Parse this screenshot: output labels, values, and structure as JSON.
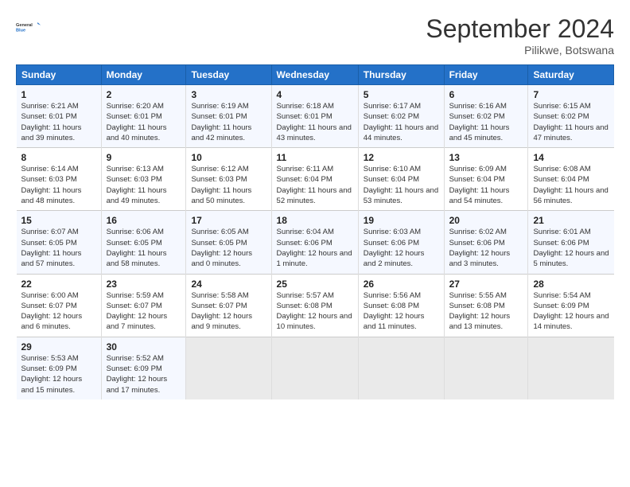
{
  "header": {
    "logo_line1": "General",
    "logo_line2": "Blue",
    "month": "September 2024",
    "location": "Pilikwe, Botswana"
  },
  "days_of_week": [
    "Sunday",
    "Monday",
    "Tuesday",
    "Wednesday",
    "Thursday",
    "Friday",
    "Saturday"
  ],
  "weeks": [
    [
      {
        "day": "1",
        "sunrise": "6:21 AM",
        "sunset": "6:01 PM",
        "daylight": "11 hours and 39 minutes."
      },
      {
        "day": "2",
        "sunrise": "6:20 AM",
        "sunset": "6:01 PM",
        "daylight": "11 hours and 40 minutes."
      },
      {
        "day": "3",
        "sunrise": "6:19 AM",
        "sunset": "6:01 PM",
        "daylight": "11 hours and 42 minutes."
      },
      {
        "day": "4",
        "sunrise": "6:18 AM",
        "sunset": "6:01 PM",
        "daylight": "11 hours and 43 minutes."
      },
      {
        "day": "5",
        "sunrise": "6:17 AM",
        "sunset": "6:02 PM",
        "daylight": "11 hours and 44 minutes."
      },
      {
        "day": "6",
        "sunrise": "6:16 AM",
        "sunset": "6:02 PM",
        "daylight": "11 hours and 45 minutes."
      },
      {
        "day": "7",
        "sunrise": "6:15 AM",
        "sunset": "6:02 PM",
        "daylight": "11 hours and 47 minutes."
      }
    ],
    [
      {
        "day": "8",
        "sunrise": "6:14 AM",
        "sunset": "6:03 PM",
        "daylight": "11 hours and 48 minutes."
      },
      {
        "day": "9",
        "sunrise": "6:13 AM",
        "sunset": "6:03 PM",
        "daylight": "11 hours and 49 minutes."
      },
      {
        "day": "10",
        "sunrise": "6:12 AM",
        "sunset": "6:03 PM",
        "daylight": "11 hours and 50 minutes."
      },
      {
        "day": "11",
        "sunrise": "6:11 AM",
        "sunset": "6:04 PM",
        "daylight": "11 hours and 52 minutes."
      },
      {
        "day": "12",
        "sunrise": "6:10 AM",
        "sunset": "6:04 PM",
        "daylight": "11 hours and 53 minutes."
      },
      {
        "day": "13",
        "sunrise": "6:09 AM",
        "sunset": "6:04 PM",
        "daylight": "11 hours and 54 minutes."
      },
      {
        "day": "14",
        "sunrise": "6:08 AM",
        "sunset": "6:04 PM",
        "daylight": "11 hours and 56 minutes."
      }
    ],
    [
      {
        "day": "15",
        "sunrise": "6:07 AM",
        "sunset": "6:05 PM",
        "daylight": "11 hours and 57 minutes."
      },
      {
        "day": "16",
        "sunrise": "6:06 AM",
        "sunset": "6:05 PM",
        "daylight": "11 hours and 58 minutes."
      },
      {
        "day": "17",
        "sunrise": "6:05 AM",
        "sunset": "6:05 PM",
        "daylight": "12 hours and 0 minutes."
      },
      {
        "day": "18",
        "sunrise": "6:04 AM",
        "sunset": "6:06 PM",
        "daylight": "12 hours and 1 minute."
      },
      {
        "day": "19",
        "sunrise": "6:03 AM",
        "sunset": "6:06 PM",
        "daylight": "12 hours and 2 minutes."
      },
      {
        "day": "20",
        "sunrise": "6:02 AM",
        "sunset": "6:06 PM",
        "daylight": "12 hours and 3 minutes."
      },
      {
        "day": "21",
        "sunrise": "6:01 AM",
        "sunset": "6:06 PM",
        "daylight": "12 hours and 5 minutes."
      }
    ],
    [
      {
        "day": "22",
        "sunrise": "6:00 AM",
        "sunset": "6:07 PM",
        "daylight": "12 hours and 6 minutes."
      },
      {
        "day": "23",
        "sunrise": "5:59 AM",
        "sunset": "6:07 PM",
        "daylight": "12 hours and 7 minutes."
      },
      {
        "day": "24",
        "sunrise": "5:58 AM",
        "sunset": "6:07 PM",
        "daylight": "12 hours and 9 minutes."
      },
      {
        "day": "25",
        "sunrise": "5:57 AM",
        "sunset": "6:08 PM",
        "daylight": "12 hours and 10 minutes."
      },
      {
        "day": "26",
        "sunrise": "5:56 AM",
        "sunset": "6:08 PM",
        "daylight": "12 hours and 11 minutes."
      },
      {
        "day": "27",
        "sunrise": "5:55 AM",
        "sunset": "6:08 PM",
        "daylight": "12 hours and 13 minutes."
      },
      {
        "day": "28",
        "sunrise": "5:54 AM",
        "sunset": "6:09 PM",
        "daylight": "12 hours and 14 minutes."
      }
    ],
    [
      {
        "day": "29",
        "sunrise": "5:53 AM",
        "sunset": "6:09 PM",
        "daylight": "12 hours and 15 minutes."
      },
      {
        "day": "30",
        "sunrise": "5:52 AM",
        "sunset": "6:09 PM",
        "daylight": "12 hours and 17 minutes."
      },
      null,
      null,
      null,
      null,
      null
    ]
  ]
}
